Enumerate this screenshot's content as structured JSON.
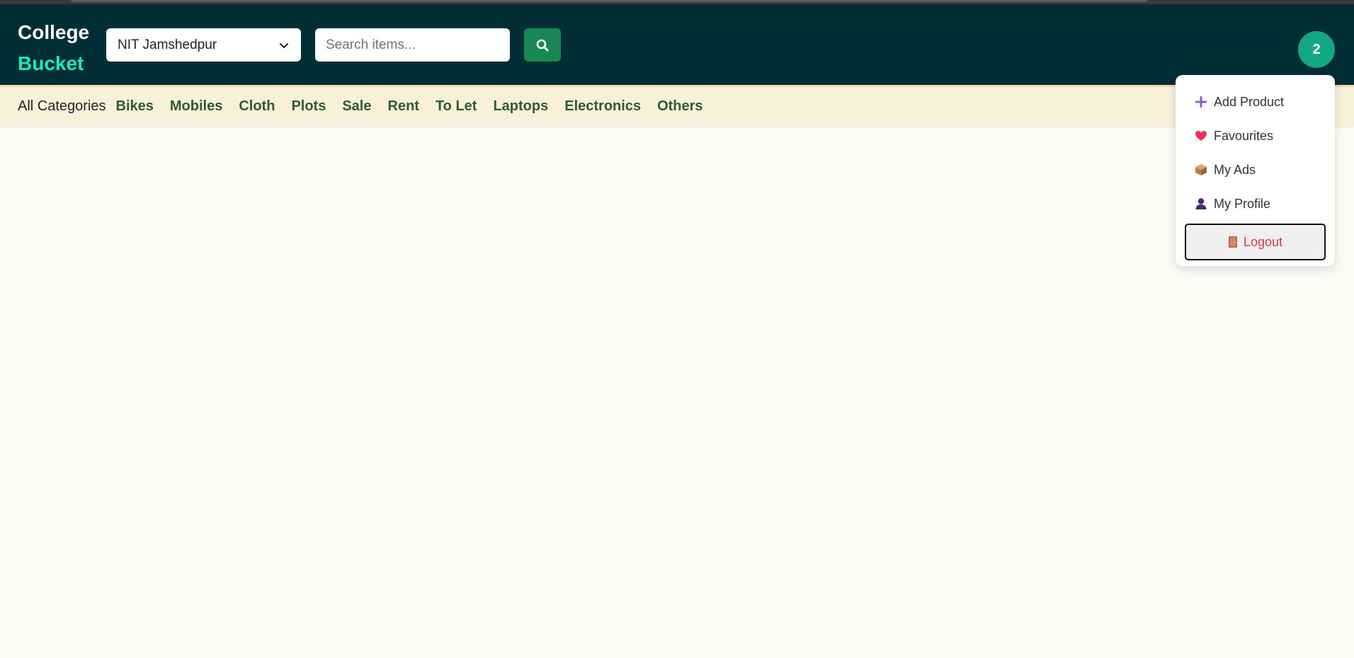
{
  "brand": {
    "line1": "College",
    "line2": "Bucket"
  },
  "location": {
    "selected": "NIT Jamshedpur"
  },
  "search": {
    "placeholder": "Search items...",
    "value": ""
  },
  "avatar": {
    "initial": "2"
  },
  "categories": {
    "all_label": "All Categories",
    "items": [
      "Bikes",
      "Mobiles",
      "Cloth",
      "Plots",
      "Sale",
      "Rent",
      "To Let",
      "Laptops",
      "Electronics",
      "Others"
    ]
  },
  "user_menu": {
    "items": [
      {
        "label": "Add Product",
        "icon": "plus-icon"
      },
      {
        "label": "Favourites",
        "icon": "heart-icon"
      },
      {
        "label": "My Ads",
        "icon": "package-icon"
      },
      {
        "label": "My Profile",
        "icon": "person-icon"
      }
    ],
    "logout": {
      "label": "Logout",
      "icon": "door-icon"
    }
  },
  "colors": {
    "navbar": "#002e35",
    "brand_accent": "#1de9b6",
    "search_button": "#198754",
    "avatar": "#12a884",
    "category_bar": "#f9f0d9",
    "category_text": "#2e5a35",
    "logout_text": "#dc3545"
  }
}
